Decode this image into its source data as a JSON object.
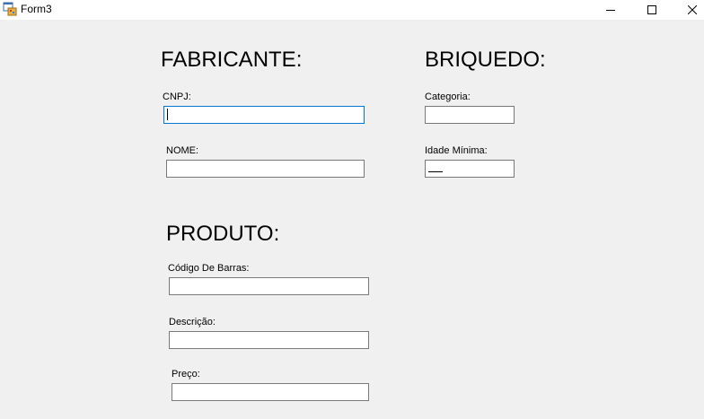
{
  "window": {
    "title": "Form3",
    "icon": "winforms-app-icon",
    "controls": [
      "minimize-icon",
      "maximize-icon",
      "close-icon"
    ]
  },
  "fabricante": {
    "heading": "FABRICANTE:",
    "cnpj_label": "CNPJ:",
    "cnpj_value": "",
    "nome_label": "NOME:",
    "nome_value": ""
  },
  "brinquedo": {
    "heading": "BRIQUEDO:",
    "categoria_label": "Categoria:",
    "categoria_value": "",
    "idade_label": "Idade Mínima:",
    "idade_value": ""
  },
  "produto": {
    "heading": "PRODUTO:",
    "codigo_label": "Código De Barras:",
    "codigo_value": "",
    "descricao_label": "Descrição:",
    "descricao_value": "",
    "preco_label": "Preço:",
    "preco_value": ""
  },
  "colors": {
    "window_bg": "#f0f0f0",
    "focus_border": "#0078d7",
    "field_border": "#7a7a7a"
  }
}
